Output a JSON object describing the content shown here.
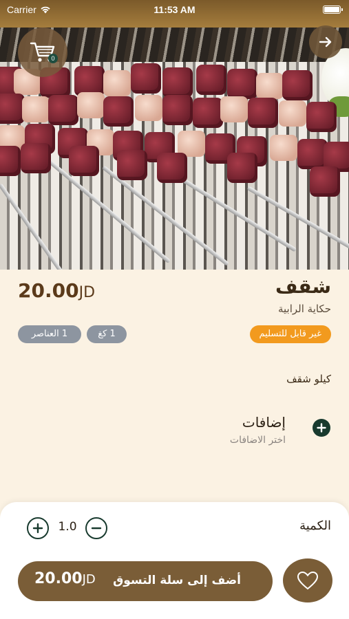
{
  "status_bar": {
    "carrier": "Carrier",
    "time": "11:53 AM"
  },
  "header": {
    "cart_badge_count": "0"
  },
  "product": {
    "name": "شقف",
    "restaurant": "حكاية الرابية",
    "price_value": "20.00",
    "currency": "JD",
    "delivery_badge": "غير قابل للتسليم",
    "size_badge": "1 كغ",
    "items_badge": "1 العناصر",
    "description": "كيلو شقف"
  },
  "addons": {
    "title": "إضافات",
    "subtitle": "اختر الاضافات"
  },
  "bottom": {
    "quantity_label": "الكمية",
    "quantity_value": "1.0",
    "add_to_cart_label": "أضف إلى سلة التسوق",
    "total_value": "20.00",
    "currency": "JD"
  },
  "colors": {
    "background": "#fbf2e3",
    "brand_brown": "#7a5d37",
    "dark_green": "#183a2e",
    "orange_badge": "#f29a1e",
    "gray_badge": "#8d95a0"
  },
  "icons": {
    "cart": "shopping-cart-icon",
    "back": "arrow-right-icon",
    "add_addon": "plus-circle-icon",
    "increment": "plus-circle-outline-icon",
    "decrement": "minus-circle-outline-icon",
    "favorite": "heart-outline-icon",
    "wifi": "wifi-icon",
    "battery": "battery-icon"
  }
}
